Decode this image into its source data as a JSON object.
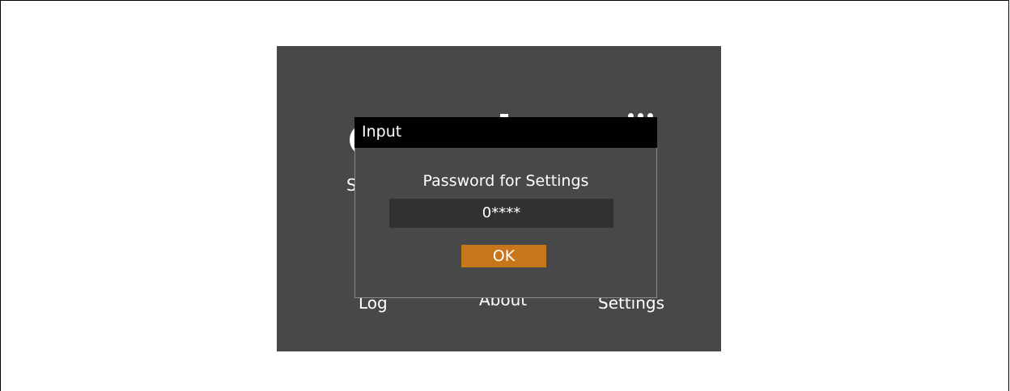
{
  "background_menu": {
    "items": [
      {
        "label": "S",
        "icon": "status-icon"
      },
      {
        "label": "Log",
        "icon": "log-icon"
      },
      {
        "label": "About",
        "icon": "about-icon"
      },
      {
        "label": "Settings",
        "icon": "settings-icon"
      }
    ]
  },
  "dialog": {
    "title": "Input",
    "prompt": "Password for Settings",
    "password_value": "0****",
    "ok_label": "OK"
  },
  "colors": {
    "screen_bg": "#474948",
    "titlebar_bg": "#010101",
    "field_bg": "#313131",
    "ok_button_bg": "#c77619"
  }
}
